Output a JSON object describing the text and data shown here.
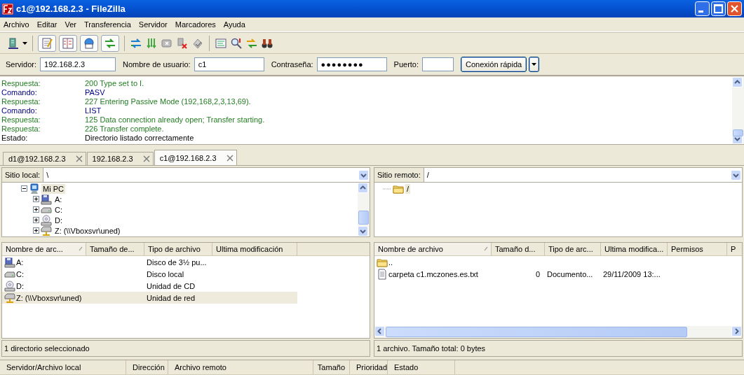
{
  "window": {
    "title": "c1@192.168.2.3 - FileZilla"
  },
  "menu": [
    {
      "label": "Archivo"
    },
    {
      "label": "Editar"
    },
    {
      "label": "Ver"
    },
    {
      "label": "Transferencia"
    },
    {
      "label": "Servidor"
    },
    {
      "label": "Marcadores"
    },
    {
      "label": "Ayuda"
    }
  ],
  "toolbar": {
    "toggles": [
      {
        "on": true
      },
      {
        "on": true
      },
      {
        "on": true
      },
      {
        "on": true
      }
    ]
  },
  "quickconnect": {
    "fields": [
      {
        "label": "Servidor:",
        "value": "192.168.2.3",
        "kind": "text"
      },
      {
        "label": "Nombre de usuario:",
        "value": "c1",
        "kind": "text"
      },
      {
        "label": "Contraseña:",
        "value": "●●●●●●●●",
        "kind": "password"
      },
      {
        "label": "Puerto:",
        "kind": "text"
      }
    ],
    "button": "Conexión rápida"
  },
  "log": [
    {
      "kind": "response",
      "label": "Respuesta:",
      "message": "200 Type set to I."
    },
    {
      "kind": "command",
      "label": "Comando:",
      "message": "PASV"
    },
    {
      "kind": "response",
      "label": "Respuesta:",
      "message": "227 Entering Passive Mode (192,168,2,3,13,69)."
    },
    {
      "kind": "command",
      "label": "Comando:",
      "message": "LIST"
    },
    {
      "kind": "response",
      "label": "Respuesta:",
      "message": "125 Data connection already open; Transfer starting."
    },
    {
      "kind": "response",
      "label": "Respuesta:",
      "message": "226 Transfer complete."
    },
    {
      "kind": "status",
      "label": "Estado:",
      "message": "Directorio listado correctamente"
    }
  ],
  "tabs": [
    {
      "label": "d1@192.168.2.3",
      "selected": false
    },
    {
      "label": "192.168.2.3",
      "selected": false
    },
    {
      "label": "c1@192.168.2.3",
      "selected": true
    }
  ],
  "local": {
    "site_label": "Sitio local:",
    "path": "\\",
    "tree": [
      {
        "label": "Mi PC",
        "kind": "computer",
        "expanded": true,
        "selected": true,
        "children": [
          {
            "label": "A:",
            "kind": "floppy",
            "expanded": false,
            "selected": false
          },
          {
            "label": "C:",
            "kind": "hdd",
            "expanded": false,
            "selected": false
          },
          {
            "label": "D:",
            "kind": "cd",
            "expanded": false,
            "selected": false
          },
          {
            "label": "Z: (\\\\Vboxsvr\\uned)",
            "kind": "network",
            "expanded": false,
            "selected": false
          }
        ]
      }
    ],
    "columns": [
      {
        "label": "Nombre de arc...",
        "sorted": true
      },
      {
        "label": "Tamaño de...",
        "sorted": false
      },
      {
        "label": "Tipo de archivo",
        "sorted": false
      },
      {
        "label": "Ultima modificación",
        "sorted": false
      }
    ],
    "rows": [
      {
        "kind": "floppy",
        "name": "A:",
        "type": "Disco de 3½ pu...",
        "selected": false
      },
      {
        "kind": "hdd",
        "name": "C:",
        "type": "Disco local",
        "selected": false
      },
      {
        "kind": "cd",
        "name": "D:",
        "type": "Unidad de CD",
        "selected": false
      },
      {
        "kind": "network",
        "name": "Z: (\\\\Vboxsvr\\uned)",
        "type": "Unidad de red",
        "selected": true
      }
    ],
    "status": "1 directorio seleccionado"
  },
  "remote": {
    "site_label": "Sitio remoto:",
    "path": "/",
    "tree": [
      {
        "label": "/",
        "kind": "folder",
        "selected": true
      }
    ],
    "columns": [
      {
        "label": "Nombre de archivo",
        "sorted": true
      },
      {
        "label": "Tamaño d...",
        "sorted": false
      },
      {
        "label": "Tipo de arc...",
        "sorted": false
      },
      {
        "label": "Ultima modifica...",
        "sorted": false
      },
      {
        "label": "Permisos",
        "sorted": false
      },
      {
        "label": "P",
        "sorted": false
      }
    ],
    "rows": [
      {
        "kind": "folder",
        "name": "..",
        "selected": false
      },
      {
        "kind": "file",
        "name": "carpeta c1.mczones.es.txt",
        "size": "0",
        "type": "Documento...",
        "modified": "29/11/2009 13:...",
        "selected": false
      }
    ],
    "status": "1 archivo. Tamaño total: 0 bytes"
  },
  "queue": {
    "columns": [
      "Servidor/Archivo local",
      "Dirección",
      "Archivo remoto",
      "Tamaño",
      "Prioridad",
      "Estado"
    ]
  }
}
